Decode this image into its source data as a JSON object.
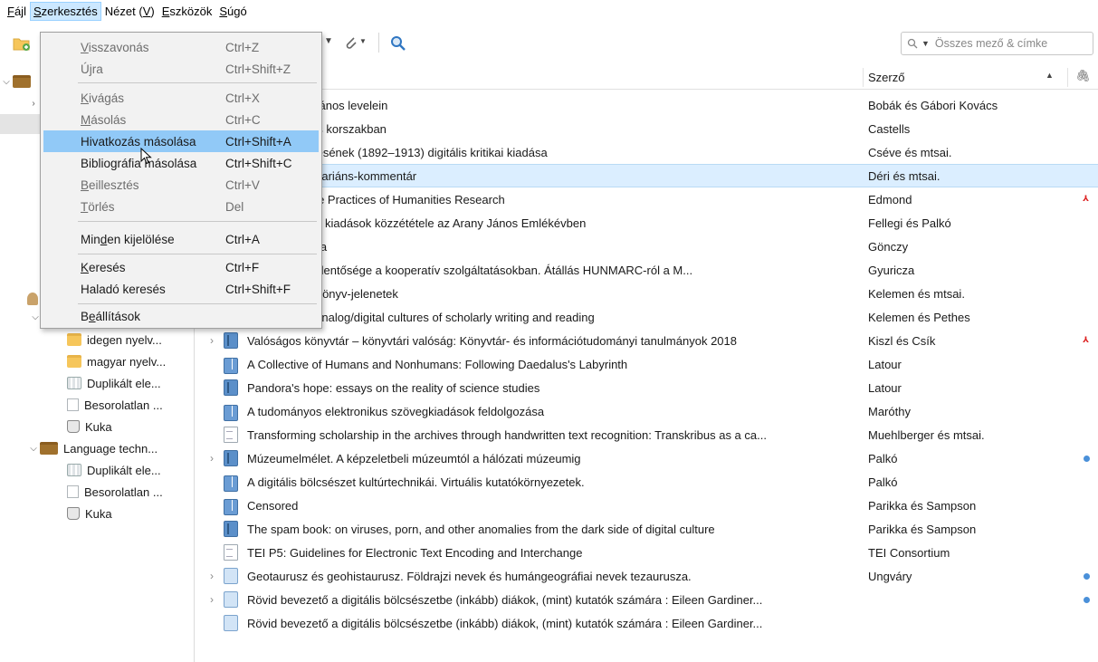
{
  "menubar": {
    "items": [
      {
        "pre": "",
        "ul": "F",
        "post": "ájl"
      },
      {
        "pre": "",
        "ul": "S",
        "post": "zerkesztés"
      },
      {
        "pre": "Nézet (",
        "ul": "V",
        "post": ")"
      },
      {
        "pre": "",
        "ul": "E",
        "post": "szközök"
      },
      {
        "pre": "",
        "ul": "S",
        "post": "úgó"
      }
    ]
  },
  "toolbar": {
    "search_placeholder": "Összes mező & címke",
    "search_icon": "search-icon",
    "colors": {
      "accent": "#91c9f7",
      "selected_row": "#dbeeff"
    }
  },
  "columns": {
    "author": "Szerző"
  },
  "collections": [
    {
      "label": "idegen nyelv...",
      "icon": "folder-icon"
    },
    {
      "label": "magyar nyelv...",
      "icon": "folder-icon"
    },
    {
      "label": "Duplikált ele...",
      "icon": "duplicate-items-icon"
    },
    {
      "label": "Besorolatlan ...",
      "icon": "unfiled-items-icon"
    },
    {
      "label": "Kuka",
      "icon": "trash-icon"
    },
    {
      "label": "Language techn...",
      "icon": "group-library-icon"
    },
    {
      "label": "Duplikált ele...",
      "icon": "duplicate-items-icon"
    },
    {
      "label": "Besorolatlan ...",
      "icon": "unfiled-items-icon"
    },
    {
      "label": "Kuka",
      "icon": "trash-icon"
    }
  ],
  "items": [
    {
      "title": "nerés Arany János levelein",
      "author": "Bobák és Gábori Kovács"
    },
    {
      "title": "az információs korszakban",
      "author": "Castells"
    },
    {
      "title": "mond levelezésének (1892–1913) digitális kritikai kiadása",
      "author": "Cséve és mtsai."
    },
    {
      "title": "ia. I: Szöveg-variáns-kommentár",
      "author": "Déri és mtsai."
    },
    {
      "title": "nology and the Practices of Humanities Research",
      "author": "Edmond"
    },
    {
      "title": "atok és kritikai kiadások közzététele az Arany János Emlékévben",
      "author": "Fellegi és Palkó"
    },
    {
      "title": "nos-bibliográfia",
      "author": "Gönczy"
    },
    {
      "title": "metaadatok jelentősége a kooperatív szolgáltatásokban. Átállás HUNMARC-ról a M...",
      "author": "Gyuricza"
    },
    {
      "title": "ia. II: Szerző-könyv-jelenetek",
      "author": "Kelemen és mtsai."
    },
    {
      "title": "the making : Analog/digital cultures of scholarly writing and reading",
      "author": "Kelemen és Pethes"
    },
    {
      "title": "Valóságos könyvtár – könyvtári valóság: Könyvtár- és információtudományi tanulmányok 2018",
      "author": "Kiszl és Csík"
    },
    {
      "title": "A Collective of Humans and Nonhumans: Following Daedalus's Labyrinth",
      "author": "Latour"
    },
    {
      "title": "Pandora's hope: essays on the reality of science studies",
      "author": "Latour"
    },
    {
      "title": "A tudományos elektronikus szövegkiadások feldolgozása",
      "author": "Maróthy"
    },
    {
      "title": "Transforming scholarship in the archives through handwritten text recognition: Transkribus as a ca...",
      "author": "Muehlberger és mtsai."
    },
    {
      "title": "Múzeumelmélet. A képzeletbeli múzeumtól a hálózati múzeumig",
      "author": "Palkó"
    },
    {
      "title": "A digitális bölcsészet kultúrtechnikái. Virtuális kutatókörnyezetek.",
      "author": "Palkó"
    },
    {
      "title": "Censored",
      "author": "Parikka és Sampson"
    },
    {
      "title": "The spam book: on viruses, porn, and other anomalies from the dark side of digital culture",
      "author": "Parikka és Sampson"
    },
    {
      "title": "TEI P5: Guidelines for Electronic Text Encoding and Interchange",
      "author": "TEI Consortium"
    },
    {
      "title": "Geotaurusz és geohistaurusz. Földrajzi nevek és humángeográfiai nevek tezaurusza.",
      "author": "Ungváry"
    },
    {
      "title": "Rövid bevezető a digitális bölcsészetbe (inkább) diákok, (mint) kutatók számára : Eileen Gardiner...",
      "author": ""
    },
    {
      "title": "Rövid bevezető a digitális bölcsészetbe (inkább) diákok, (mint) kutatók számára : Eileen Gardiner...",
      "author": ""
    }
  ],
  "edit_menu": {
    "undo": {
      "pre": "",
      "ul": "V",
      "post": "isszavonás",
      "shortcut": "Ctrl+Z"
    },
    "redo": {
      "pre": "Ú",
      "ul": "j",
      "post": "ra",
      "shortcut": "Ctrl+Shift+Z"
    },
    "cut": {
      "pre": "",
      "ul": "K",
      "post": "ivágás",
      "shortcut": "Ctrl+X"
    },
    "copy": {
      "pre": "",
      "ul": "M",
      "post": "ásolás",
      "shortcut": "Ctrl+C"
    },
    "copy_citation": {
      "label": "Hivatkozás másolása",
      "shortcut": "Ctrl+Shift+A"
    },
    "copy_bibliography": {
      "label": "Bibliográfia másolása",
      "shortcut": "Ctrl+Shift+C"
    },
    "paste": {
      "pre": "",
      "ul": "B",
      "post": "eillesztés",
      "shortcut": "Ctrl+V"
    },
    "delete": {
      "pre": "",
      "ul": "T",
      "post": "örlés",
      "shortcut": "Del"
    },
    "select_all": {
      "pre": "Min",
      "ul": "d",
      "post": "en kijelölése",
      "shortcut": "Ctrl+A"
    },
    "find": {
      "pre": "",
      "ul": "K",
      "post": "eresés",
      "shortcut": "Ctrl+F"
    },
    "advanced_search": {
      "label": "Haladó keresés",
      "shortcut": "Ctrl+Shift+F"
    },
    "settings": {
      "pre": "B",
      "ul": "e",
      "post": "állítások"
    }
  }
}
